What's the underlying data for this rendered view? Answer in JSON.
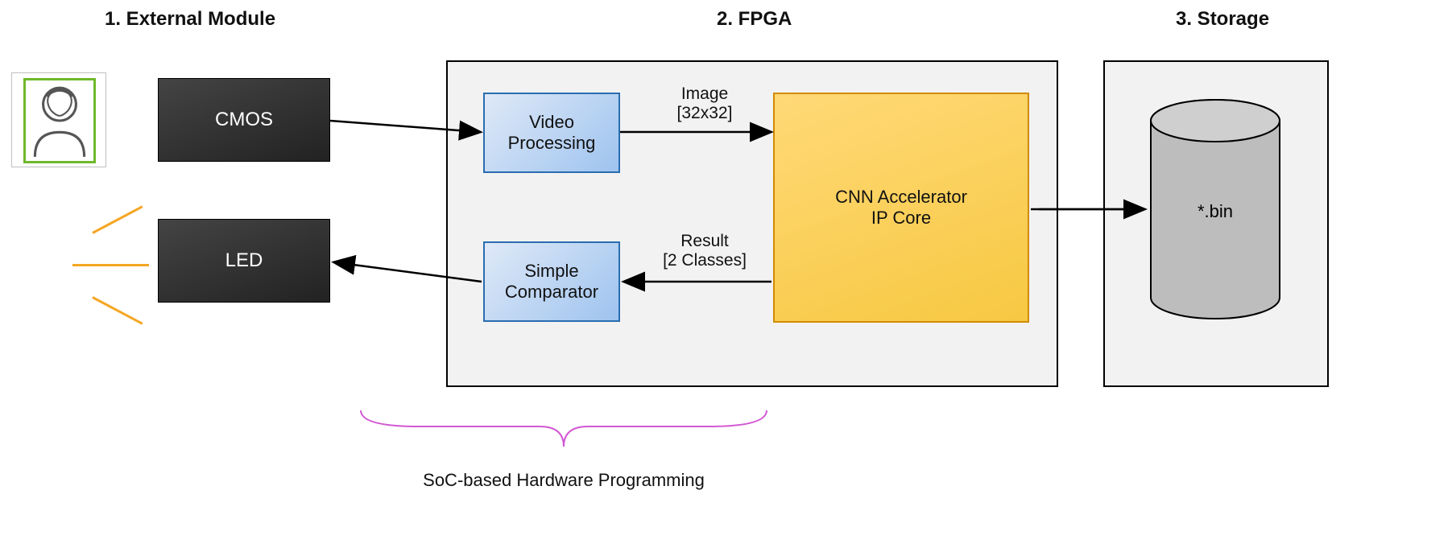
{
  "left": {
    "cmos": "CMOS",
    "led": "LED"
  },
  "sections": {
    "external": "1. External Module",
    "fpga": "2. FPGA",
    "storage": "3. Storage"
  },
  "fpga": {
    "video_processing": "Video\nProcessing",
    "simple_comparator": "Simple\nComparator",
    "cnn": "CNN Accelerator\nIP Core"
  },
  "arrows": {
    "image": "Image\n[32x32]",
    "result": "Result\n[2 Classes]"
  },
  "storage": {
    "bin": "*.bin"
  },
  "brace": {
    "title": "SoC-based Hardware Programming"
  }
}
